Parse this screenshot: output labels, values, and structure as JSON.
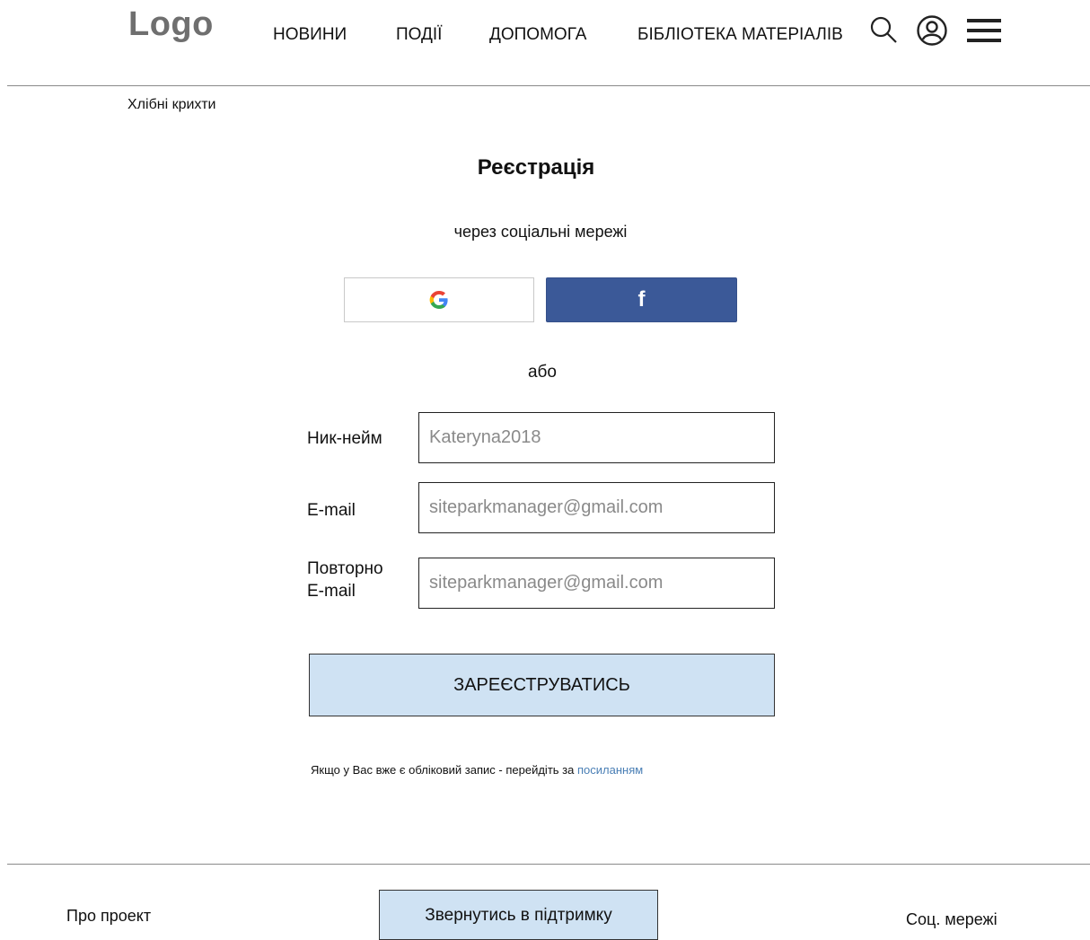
{
  "header": {
    "logo": "Logo",
    "nav": [
      "НОВИНИ",
      "ПОДІЇ",
      "ДОПОМОГА",
      "БІБЛІОТЕКА МАТЕРІАЛІВ"
    ],
    "icons": [
      "search-icon",
      "user-account-icon",
      "hamburger-menu-icon"
    ]
  },
  "breadcrumb": "Хлібні крихти",
  "registration": {
    "title": "Реєстрація",
    "social_subtitle": "через соціальні мережі",
    "social_buttons": {
      "google_letter": "G",
      "facebook_letter": "f"
    },
    "or_label": "або",
    "fields": {
      "nickname_label": "Ник-нейм",
      "nickname_value": "Kateryna2018",
      "email_label": "E-mail",
      "email_value": "siteparkmanager@gmail.com",
      "email_repeat_label_line1": "Повторно",
      "email_repeat_label_line2": "E-mail",
      "email_repeat_value": "siteparkmanager@gmail.com"
    },
    "submit_label": "ЗАРЕЄСТРУВАТИСЬ",
    "login_note_text": "Якщо у Вас вже є обліковий запис - перейдіть за",
    "login_link_text": "посиланням"
  },
  "footer": {
    "about": "Про проект",
    "support_button": "Звернутись в підтримку",
    "social": "Соц. мережі"
  },
  "colors": {
    "facebook": "#3b5998",
    "primary_button": "#cfe2f3",
    "link": "#4a7fb5"
  }
}
